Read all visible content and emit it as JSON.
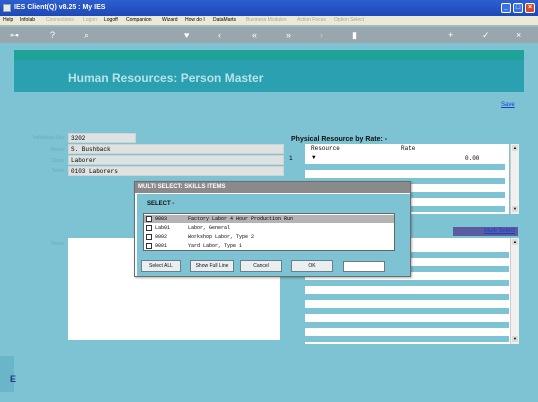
{
  "window": {
    "title": "IES Client(Q) v8.25 : My IES"
  },
  "menu": [
    {
      "label": "Help",
      "disabled": false
    },
    {
      "label": "Infolab",
      "disabled": false
    },
    {
      "label": "Connections",
      "disabled": true
    },
    {
      "label": "Logon",
      "disabled": true
    },
    {
      "label": "Logoff",
      "disabled": false
    },
    {
      "label": "Companion",
      "disabled": false
    },
    {
      "label": "Wizard",
      "disabled": false
    },
    {
      "label": "How do I",
      "disabled": false
    },
    {
      "label": "DataMarts",
      "disabled": false
    },
    {
      "label": "Business Modules",
      "disabled": true
    },
    {
      "label": "Action Focus",
      "disabled": true
    },
    {
      "label": "Option Select",
      "disabled": true
    }
  ],
  "page": {
    "title": "Human Resources: Person Master",
    "save_label": "Save"
  },
  "form": {
    "individual_key_label": "Individual Key",
    "individual_key_value": "3202",
    "name_label": "Name",
    "name_value": "S. Bushback",
    "class_label": "Class",
    "class_value": "Laborer",
    "team_label": "Team",
    "team_value": "0103 Laborers",
    "notes_label": "Notes"
  },
  "physical_resource": {
    "title": "Physical Resource by Rate: -",
    "col_resource": "Resource",
    "col_rate": "Rate",
    "row_index": "1",
    "row_marker": "▼",
    "row_rate": "0.00"
  },
  "multi_select_link": "Multi Select",
  "modal": {
    "title": "MULTI SELECT: SKILLS ITEMS",
    "select_label": "SELECT -",
    "items": [
      {
        "code": "9003",
        "description": "Factory Labor 4 Hour Production Run",
        "selected": true
      },
      {
        "code": "Lab01",
        "description": "Labor, General",
        "selected": false
      },
      {
        "code": "9002",
        "description": "Workshop Labor, Type 2",
        "selected": false
      },
      {
        "code": "9001",
        "description": "Yard Labor, Type 1",
        "selected": false
      }
    ],
    "buttons": {
      "select_all": "Select ALL",
      "show_full_line": "Show Full Line",
      "cancel": "Cancel",
      "ok": "OK"
    }
  },
  "left_edge_letter": "E",
  "icons": [
    "key-icon",
    "help-icon",
    "search-icon",
    "heart-icon",
    "back-icon",
    "forward-icon",
    "rewind-icon",
    "fastforward-icon",
    "trash-icon",
    "plus-icon",
    "check-icon",
    "close-icon"
  ]
}
